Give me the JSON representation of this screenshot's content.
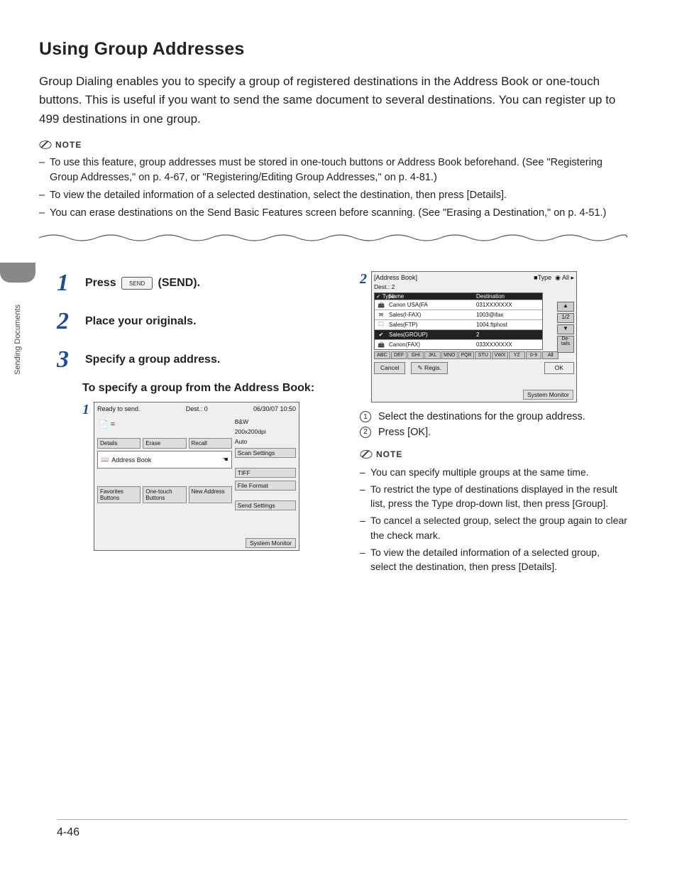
{
  "sideTabLabel": "Sending Documents",
  "pageNumber": "4-46",
  "title": "Using Group Addresses",
  "intro": "Group Dialing enables you to specify a group of registered destinations in the Address Book or one-touch buttons. This is useful if you want to send the same document to several destinations. You can register up to 499 destinations in one group.",
  "noteLabel": "NOTE",
  "notes": [
    "To use this feature, group addresses must be stored in one-touch buttons or Address Book beforehand. (See \"Registering Group Addresses,\" on p. 4-67, or \"Registering/Editing Group Addresses,\" on p. 4-81.)",
    "To view the detailed information of a selected destination, select the destination, then press [Details].",
    "You can erase destinations on the Send Basic Features screen before scanning. (See \"Erasing a Destination,\" on p. 4-51.)"
  ],
  "steps": {
    "1": {
      "pre": "Press ",
      "key": "SEND",
      "post": " (SEND)."
    },
    "2": "Place your originals.",
    "3": "Specify a group address.",
    "3sub": "To specify a group from the Address Book:"
  },
  "ss1": {
    "status": "Ready to send.",
    "destLabel": "Dest.:",
    "destCount": "0",
    "timestamp": "06/30/07 10:50",
    "mode1": "B&W",
    "mode2": "200x200dpi",
    "mode3": "Auto",
    "btnDetails": "Details",
    "btnErase": "Erase",
    "btnRecall": "Recall",
    "btnScan": "Scan Settings",
    "btnAddr": "Address Book",
    "btnTiff": "TIFF",
    "btnFile": "File Format",
    "btnFav": "Favorites Buttons",
    "btnOne": "One-touch Buttons",
    "btnNew": "New Address",
    "btnSend": "Send Settings",
    "sysmon": "System Monitor"
  },
  "ss2": {
    "hdr": "[Address Book]",
    "typeLbl": "Type",
    "typeVal": "All",
    "destLabel": "Dest.:",
    "destCount": "2",
    "colType": "Type",
    "colName": "Name",
    "colDest": "Destination",
    "rows": [
      {
        "icon": "📠",
        "name": "Canon USA(FA",
        "dest": "031XXXXXXX",
        "sel": false
      },
      {
        "icon": "✉",
        "name": "Sales(I-FAX)",
        "dest": "1003@ifax",
        "sel": false
      },
      {
        "icon": "🗀",
        "name": "Sales(FTP)",
        "dest": "1004.ftphost",
        "sel": false
      },
      {
        "icon": "✔",
        "name": "Sales(GROUP)",
        "dest": "2",
        "sel": true
      },
      {
        "icon": "📠",
        "name": "Canon(FAX)",
        "dest": "033XXXXXXX",
        "sel": false
      }
    ],
    "alpha": [
      "ABC",
      "DEF",
      "GHI",
      "JKL",
      "MNO",
      "PQR",
      "STU",
      "VWX",
      "YZ",
      "0-9",
      "All"
    ],
    "page": "1/2",
    "detailsBtn": "De-\ntails",
    "cancel": "Cancel",
    "regis": "Regis.",
    "ok": "OK",
    "sysmon": "System Monitor"
  },
  "circList": [
    "Select the destinations for the group address.",
    "Press [OK]."
  ],
  "subNotes": [
    "You can specify multiple groups at the same time.",
    "To restrict the type of destinations displayed in the result list, press the Type drop-down list, then press [Group].",
    "To cancel a selected group, select the group again to clear the check mark.",
    "To view the detailed information of a selected group, select the destination, then press [Details]."
  ]
}
